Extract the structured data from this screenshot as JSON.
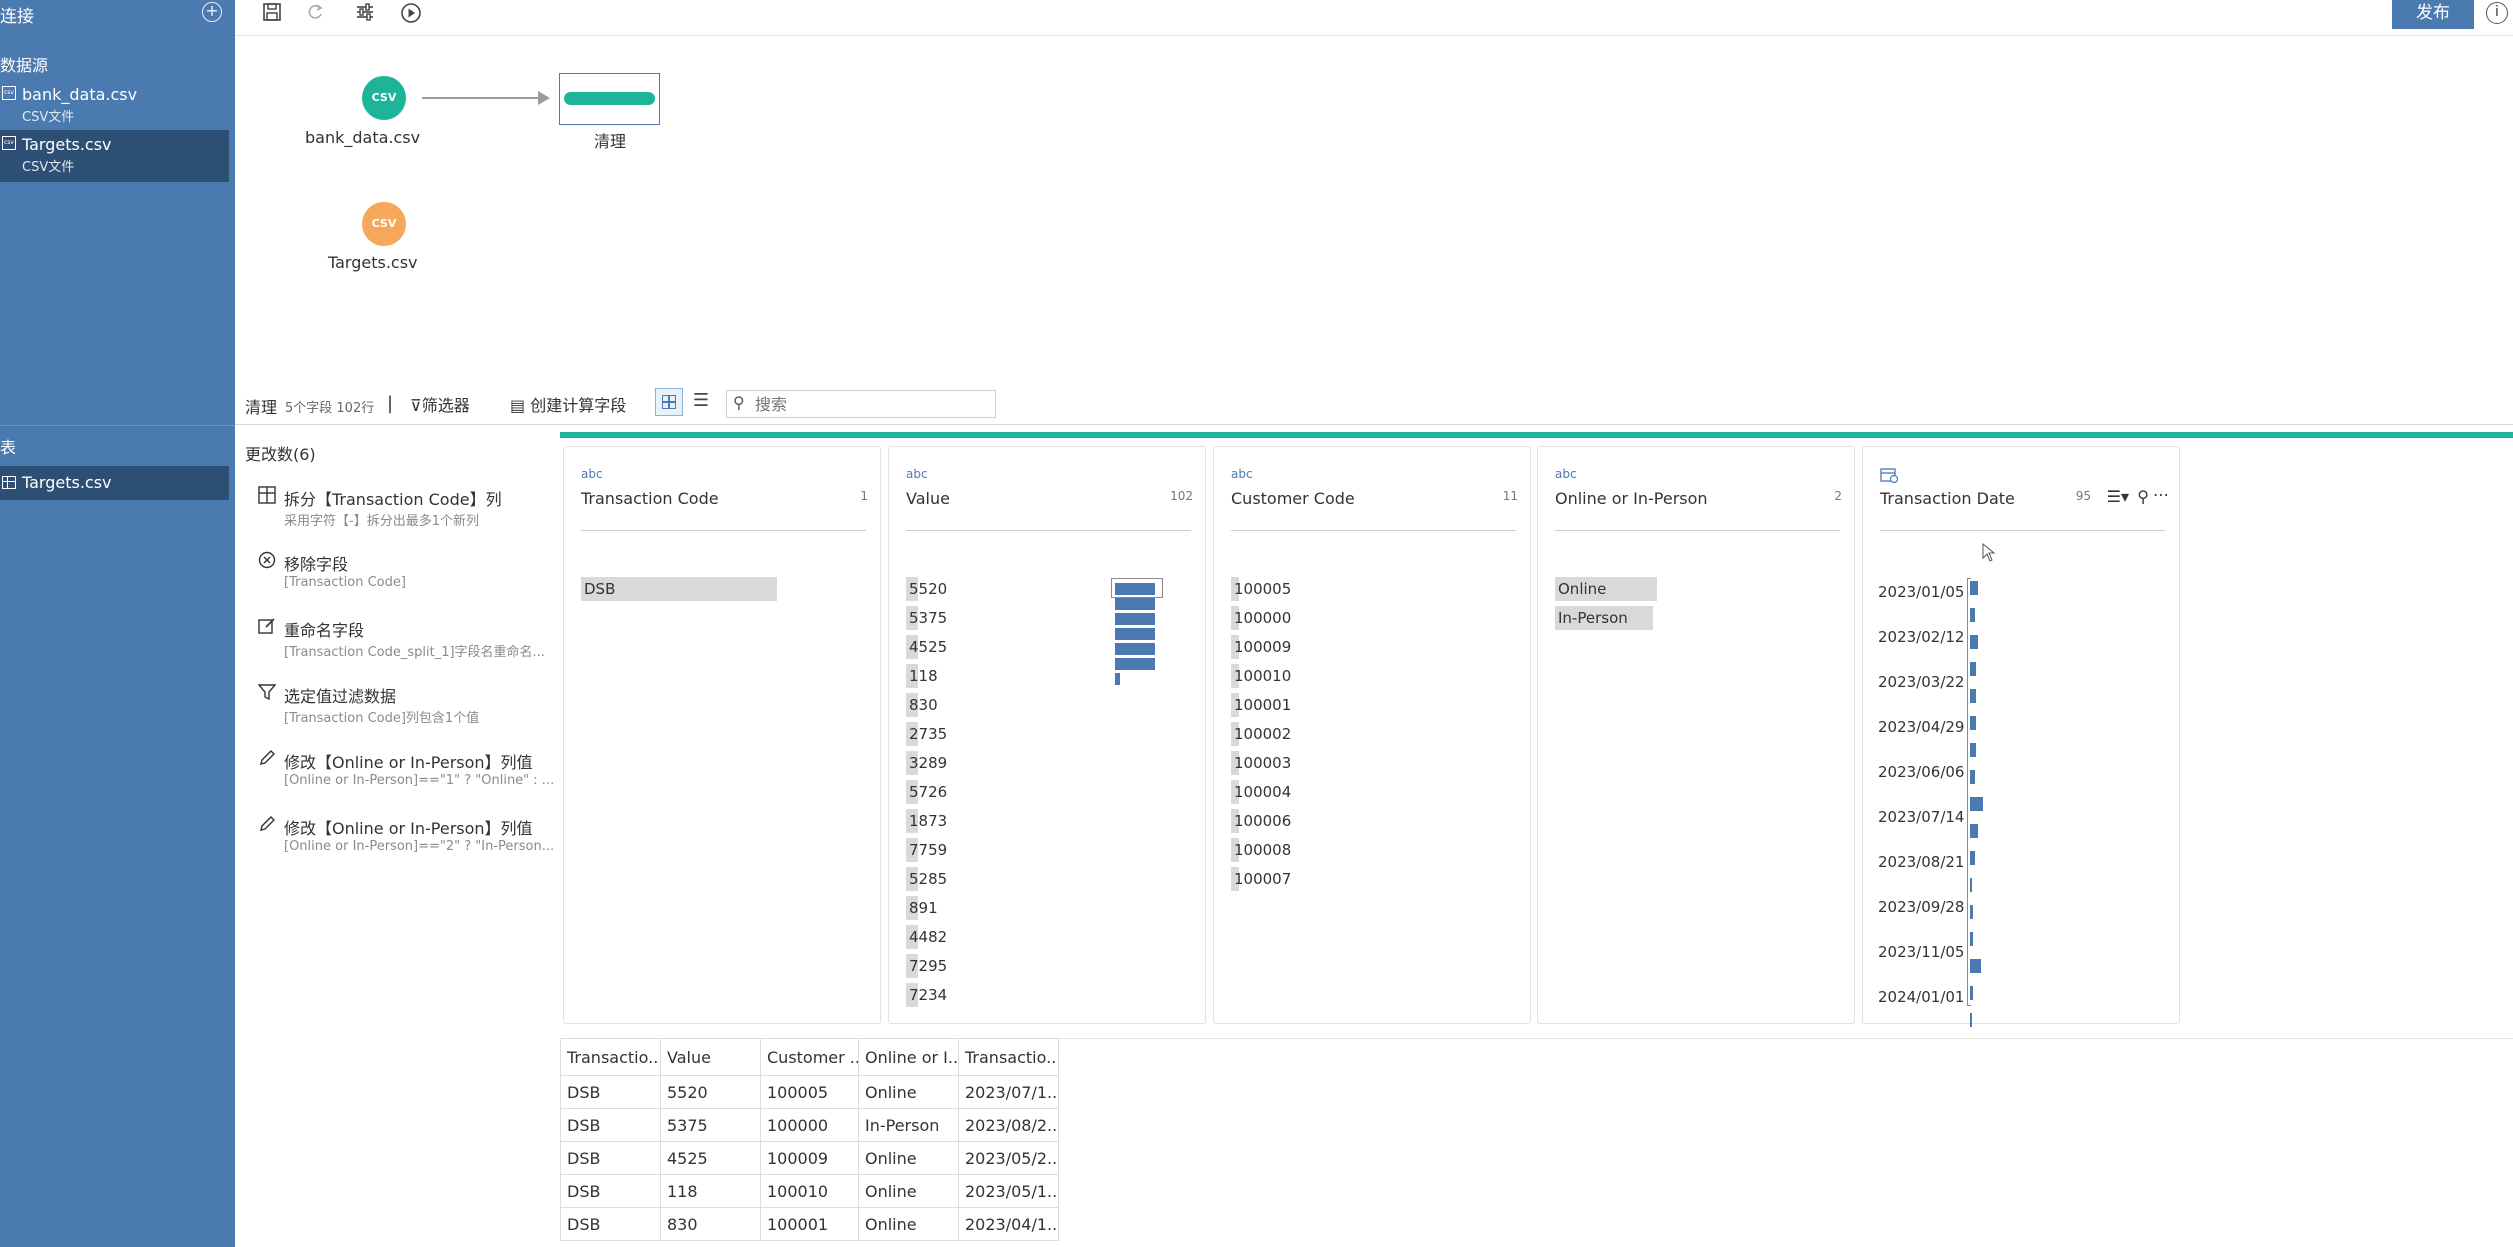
{
  "sidebar": {
    "connect_label": "连接",
    "add_icon": "+",
    "datasource_label": "数据源",
    "files": [
      {
        "name": "bank_data.csv",
        "type": "CSV文件"
      },
      {
        "name": "Targets.csv",
        "type": "CSV文件"
      }
    ],
    "table_section_label": "表",
    "table_name": "Targets.csv"
  },
  "toolbar": {
    "publish_label": "发布",
    "info_icon": "i"
  },
  "flow": {
    "nodes": [
      {
        "label": "bank_data.csv",
        "color": "#1db497"
      },
      {
        "label": "清理"
      },
      {
        "label": "Targets.csv",
        "color": "#f5a85a"
      }
    ],
    "csv_badge": "CSV"
  },
  "clean": {
    "title": "清理",
    "subtitle": "5个字段 102行",
    "separator": "|",
    "filter_label": "筛选器",
    "calc_label": "创建计算字段",
    "search_placeholder": "搜索"
  },
  "changes": {
    "title": "更改数(6)",
    "items": [
      {
        "title": "拆分【Transaction Code】列",
        "desc": "采用字符【-】拆分出最多1个新列",
        "icon": "split-icon"
      },
      {
        "title": "移除字段",
        "desc": "[Transaction Code]",
        "icon": "remove-icon"
      },
      {
        "title": "重命名字段",
        "desc": "[Transaction Code_split_1]字段名重命名...",
        "icon": "rename-icon"
      },
      {
        "title": "选定值过滤数据",
        "desc": "[Transaction Code]列包含1个值",
        "icon": "filter-icon"
      },
      {
        "title": "修改【Online or In-Person】列值",
        "desc": "[Online or In-Person]==\"1\" ? \"Online\" : ...",
        "icon": "pencil-icon"
      },
      {
        "title": "修改【Online or In-Person】列值",
        "desc": "[Online or In-Person]==\"2\" ? \"In-Person...",
        "icon": "pencil-icon"
      }
    ]
  },
  "profiles": [
    {
      "type": "abc",
      "name": "Transaction Code",
      "count": "1",
      "values": [
        "DSB"
      ]
    },
    {
      "type": "abc",
      "name": "Value",
      "count": "102",
      "values": [
        "5520",
        "5375",
        "4525",
        "118",
        "830",
        "2735",
        "3289",
        "5726",
        "1873",
        "7759",
        "5285",
        "891",
        "4482",
        "7295",
        "7234"
      ],
      "histogram": [
        0.75,
        0.75,
        0.75,
        0.75,
        0.75,
        0.75,
        0.1
      ]
    },
    {
      "type": "abc",
      "name": "Customer Code",
      "count": "11",
      "values": [
        "100005",
        "100000",
        "100009",
        "100010",
        "100001",
        "100002",
        "100003",
        "100004",
        "100006",
        "100008",
        "100007"
      ]
    },
    {
      "type": "abc",
      "name": "Online or In-Person",
      "count": "2",
      "values": [
        "Online",
        "In-Person"
      ]
    },
    {
      "type": "date",
      "name": "Transaction Date",
      "count": "95",
      "values": [
        "2023/01/05",
        "2023/02/12",
        "2023/03/22",
        "2023/04/29",
        "2023/06/06",
        "2023/07/14",
        "2023/08/21",
        "2023/09/28",
        "2023/11/05",
        "2024/01/01"
      ],
      "histogram": [
        0.5,
        0.3,
        0.5,
        0.4,
        0.4,
        0.4,
        0.4,
        0.3,
        0.8,
        0.5,
        0.3,
        0.1,
        0.2,
        0.2,
        0.7,
        0.2,
        0.1
      ]
    }
  ],
  "grid": {
    "headers": [
      "Transactio...",
      "Value",
      "Customer ...",
      "Online or I...",
      "Transactio..."
    ],
    "rows": [
      [
        "DSB",
        "5520",
        "100005",
        "Online",
        "2023/07/1..."
      ],
      [
        "DSB",
        "5375",
        "100000",
        "In-Person",
        "2023/08/2..."
      ],
      [
        "DSB",
        "4525",
        "100009",
        "Online",
        "2023/05/2..."
      ],
      [
        "DSB",
        "118",
        "100010",
        "Online",
        "2023/05/1..."
      ],
      [
        "DSB",
        "830",
        "100001",
        "Online",
        "2023/04/1..."
      ]
    ]
  },
  "colors": {
    "accent": "#4a7ab0",
    "teal": "#1db497",
    "orange": "#f5a85a",
    "selected": "#2e4f74"
  }
}
